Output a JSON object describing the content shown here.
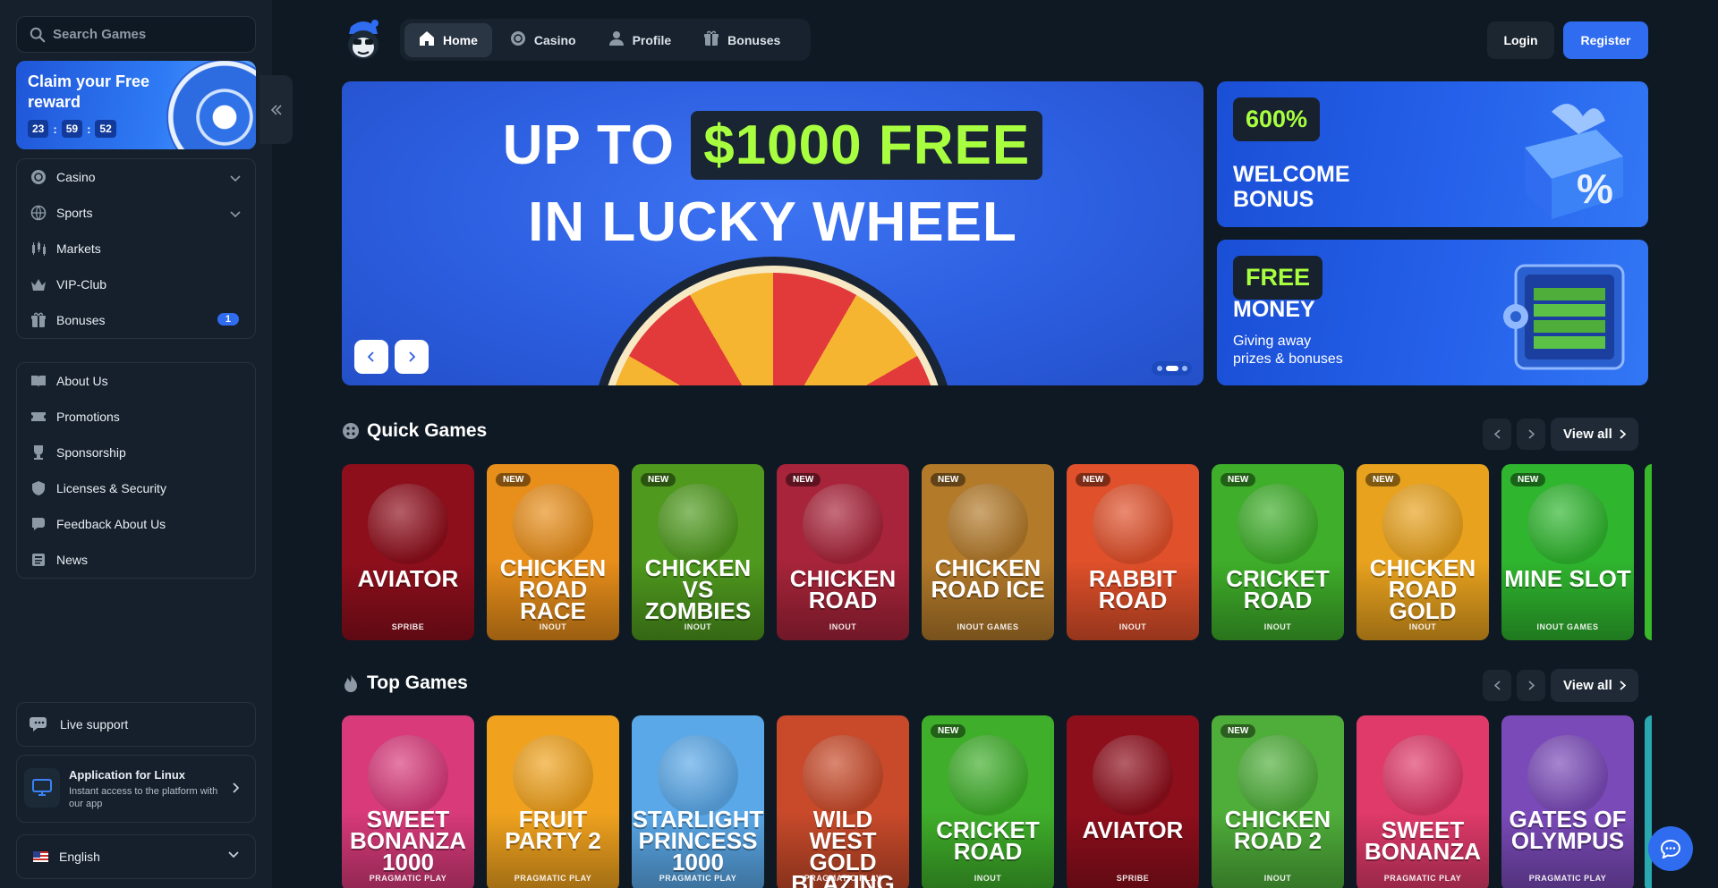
{
  "search": {
    "placeholder": "Search Games"
  },
  "reward": {
    "title": "Claim your Free reward",
    "timer": [
      "23",
      "59",
      "52"
    ]
  },
  "sidebar": {
    "main": [
      {
        "label": "Casino",
        "icon": "casino-chip-icon",
        "expandable": true
      },
      {
        "label": "Sports",
        "icon": "globe-icon",
        "expandable": true
      },
      {
        "label": "Markets",
        "icon": "candles-icon"
      },
      {
        "label": "VIP-Club",
        "icon": "crown-icon"
      },
      {
        "label": "Bonuses",
        "icon": "gift-icon",
        "badge": "1"
      }
    ],
    "info": [
      {
        "label": "About Us",
        "icon": "book-icon"
      },
      {
        "label": "Promotions",
        "icon": "ticket-icon"
      },
      {
        "label": "Sponsorship",
        "icon": "trophy-icon"
      },
      {
        "label": "Licenses & Security",
        "icon": "shield-icon"
      },
      {
        "label": "Feedback About Us",
        "icon": "chat-icon"
      },
      {
        "label": "News",
        "icon": "newspaper-icon"
      }
    ],
    "live_support": "Live support",
    "app": {
      "title": "Application for Linux",
      "subtitle": "Instant access to the platform with our app"
    },
    "language": "English"
  },
  "header": {
    "nav": [
      {
        "label": "Home",
        "icon": "home-icon",
        "active": true
      },
      {
        "label": "Casino",
        "icon": "casino-chip-icon"
      },
      {
        "label": "Profile",
        "icon": "user-icon"
      },
      {
        "label": "Bonuses",
        "icon": "gift-icon"
      }
    ],
    "login": "Login",
    "register": "Register"
  },
  "hero": {
    "line1_prefix": "UP TO",
    "line1_highlight": "$1000 FREE",
    "line2": "IN LUCKY WHEEL"
  },
  "promos": [
    {
      "tag": "600%",
      "title_lines": [
        "WELCOME",
        "BONUS"
      ]
    },
    {
      "tag": "FREE",
      "title_lines": [
        "MONEY"
      ],
      "subtitle_lines": [
        "Giving away",
        "prizes & bonuses"
      ]
    }
  ],
  "quick_games": {
    "title": "Quick Games",
    "view_all": "View all",
    "games": [
      {
        "title": "AVIATOR",
        "provider": "SPRIBE",
        "new": false,
        "bg": "#8e0f1c"
      },
      {
        "title": "CHICKEN ROAD RACE",
        "provider": "INOUT",
        "new": true,
        "bg": "#e88e1a"
      },
      {
        "title": "CHICKEN VS ZOMBIES",
        "provider": "INOUT",
        "new": true,
        "bg": "#4f9a1e"
      },
      {
        "title": "CHICKEN ROAD",
        "provider": "INOUT",
        "new": true,
        "bg": "#a8243a"
      },
      {
        "title": "CHICKEN ROAD ICE",
        "provider": "INOUT GAMES",
        "new": true,
        "bg": "#b37a2a"
      },
      {
        "title": "RABBIT ROAD",
        "provider": "INOUT",
        "new": true,
        "bg": "#e0502a"
      },
      {
        "title": "CRICKET ROAD",
        "provider": "INOUT",
        "new": true,
        "bg": "#3fae2a"
      },
      {
        "title": "CHICKEN ROAD GOLD",
        "provider": "INOUT",
        "new": true,
        "bg": "#e8a21e"
      },
      {
        "title": "MINE SLOT",
        "provider": "INOUT GAMES",
        "new": true,
        "bg": "#2fb52e"
      }
    ]
  },
  "top_games": {
    "title": "Top Games",
    "view_all": "View all",
    "games": [
      {
        "title": "SWEET BONANZA 1000",
        "provider": "PRAGMATIC PLAY",
        "new": false,
        "bg": "#d83a7a"
      },
      {
        "title": "FRUIT PARTY 2",
        "provider": "PRAGMATIC PLAY",
        "new": false,
        "bg": "#f0a21e"
      },
      {
        "title": "STARLIGHT PRINCESS 1000",
        "provider": "PRAGMATIC PLAY",
        "new": false,
        "bg": "#5aa8e8"
      },
      {
        "title": "WILD WEST GOLD BLAZING BOUNTY",
        "provider": "PRAGMATIC PLAY",
        "new": false,
        "bg": "#c84a2a"
      },
      {
        "title": "CRICKET ROAD",
        "provider": "INOUT",
        "new": true,
        "bg": "#3fae2a"
      },
      {
        "title": "AVIATOR",
        "provider": "SPRIBE",
        "new": false,
        "bg": "#8e0f1c"
      },
      {
        "title": "CHICKEN ROAD 2",
        "provider": "INOUT",
        "new": true,
        "bg": "#4fae3a"
      },
      {
        "title": "SWEET BONANZA",
        "provider": "PRAGMATIC PLAY",
        "new": false,
        "bg": "#e03a6a"
      },
      {
        "title": "GATES OF OLYMPUS",
        "provider": "PRAGMATIC PLAY",
        "new": false,
        "bg": "#7a4ab8"
      }
    ]
  }
}
